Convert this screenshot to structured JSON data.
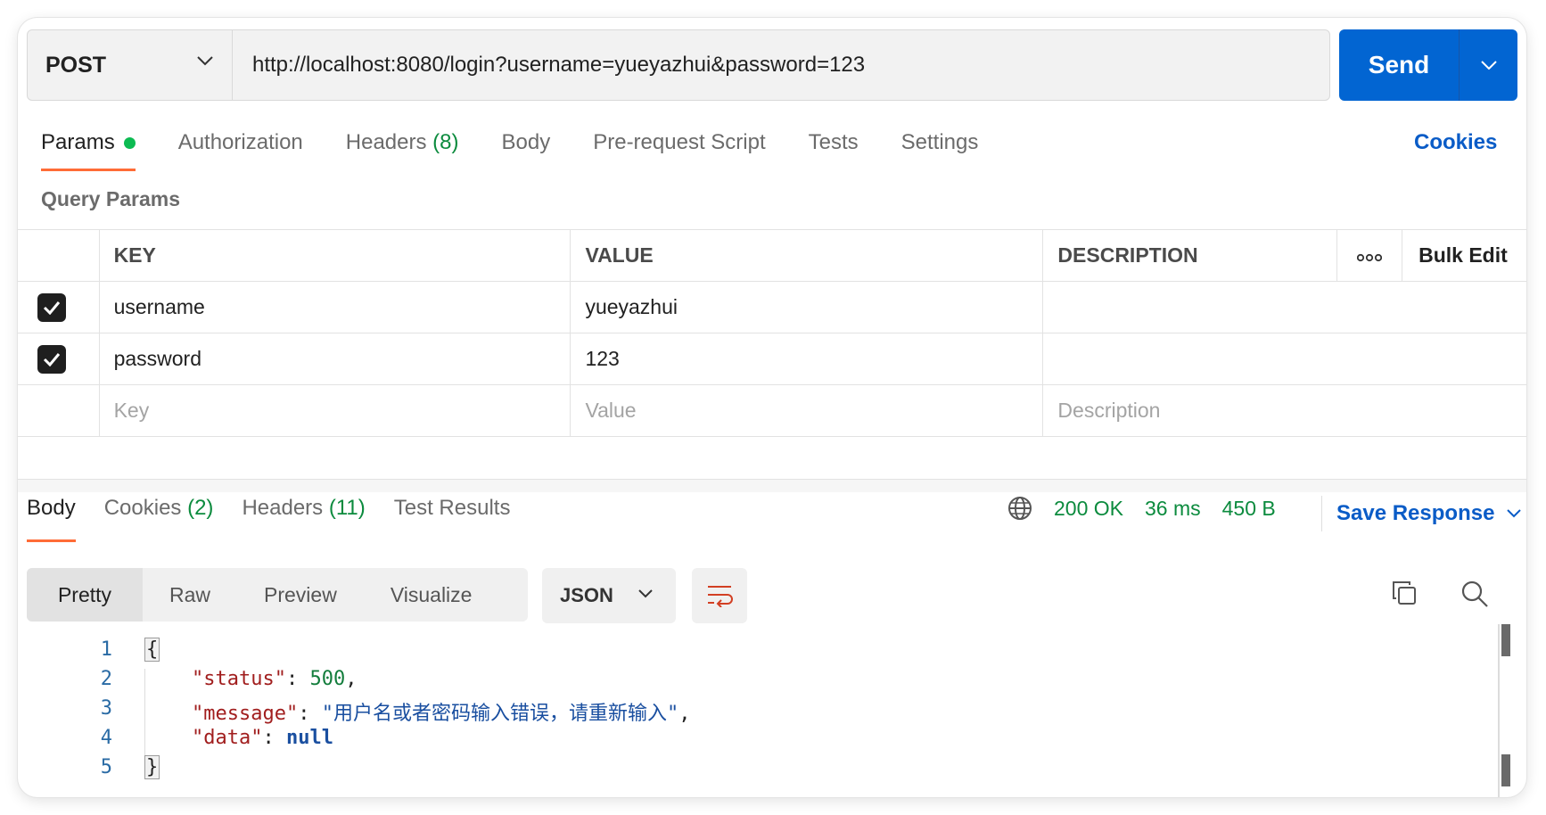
{
  "request": {
    "method": "POST",
    "url": "http://localhost:8080/login?username=yueyazhui&password=123",
    "send_label": "Send"
  },
  "request_tabs": {
    "params": "Params",
    "authorization": "Authorization",
    "headers": "Headers",
    "headers_count": "(8)",
    "body": "Body",
    "prerequest": "Pre-request Script",
    "tests": "Tests",
    "settings": "Settings",
    "cookies": "Cookies"
  },
  "query_params": {
    "title": "Query Params",
    "columns": {
      "key": "KEY",
      "value": "VALUE",
      "description": "DESCRIPTION",
      "bulk_edit": "Bulk Edit"
    },
    "rows": [
      {
        "checked": true,
        "key": "username",
        "value": "yueyazhui",
        "description": ""
      },
      {
        "checked": true,
        "key": "password",
        "value": "123",
        "description": ""
      }
    ],
    "placeholders": {
      "key": "Key",
      "value": "Value",
      "description": "Description"
    }
  },
  "response_tabs": {
    "body": "Body",
    "cookies": "Cookies",
    "cookies_count": "(2)",
    "headers": "Headers",
    "headers_count": "(11)",
    "test_results": "Test Results"
  },
  "response_status": {
    "status": "200 OK",
    "time": "36 ms",
    "size": "450 B",
    "save_response": "Save Response"
  },
  "view_modes": [
    "Pretty",
    "Raw",
    "Preview",
    "Visualize"
  ],
  "format": "JSON",
  "code": {
    "line_numbers": [
      "1",
      "2",
      "3",
      "4",
      "5"
    ],
    "open_brace": "{",
    "close_brace": "}",
    "status_key": "\"status\"",
    "status_value": "500",
    "message_key": "\"message\"",
    "message_value": "\"用户名或者密码输入错误，请重新输入\"",
    "data_key": "\"data\"",
    "data_value": "null"
  },
  "colors": {
    "send_button": "#0265d2",
    "active_tab_underline": "#ff6c37",
    "status_green": "#0c8b3e",
    "link_blue": "#0a5cc7"
  }
}
